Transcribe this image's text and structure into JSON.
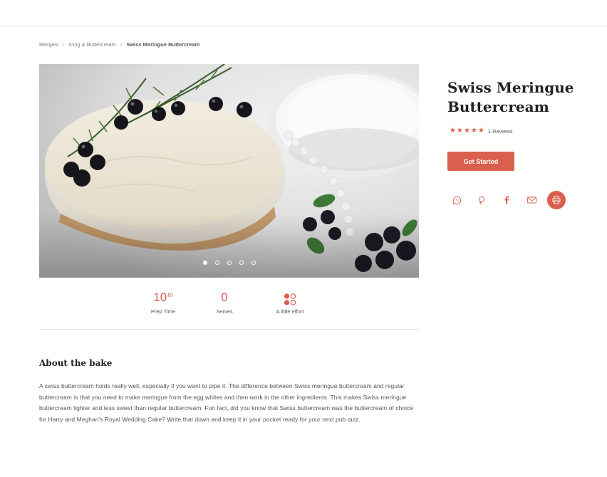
{
  "breadcrumb": {
    "items": [
      "Recipes",
      "Icing & Buttercream",
      "Swiss Meringue Buttercream"
    ],
    "separator": "›"
  },
  "hero": {
    "image_alt": "Cake topped with white buttercream, blackcurrants and rosemary",
    "slide_count": 5,
    "active_slide": 1
  },
  "stats": {
    "prep_time": {
      "value": "10",
      "unit": "m",
      "label": "Prep Time"
    },
    "serves": {
      "value": "0",
      "label": "Serves"
    },
    "effort": {
      "label": "A little effort",
      "icon": "effort-dots-icon"
    }
  },
  "about": {
    "title": "About the bake",
    "text": "A swiss buttercream holds really well, especially if you want to pipe it. The difference between Swiss meringue buttercream and regular buttercream is that you need to make meringue from the egg whites and then work in the other ingredients. This makes Swiss meringue buttercream lighter and less sweet than regular buttercream. Fun fact, did you know that Swiss buttercream was the buttercream of choice for Harry and Meghan's Royal Wedding Cake? Write that down and keep it in your pocket ready for your next pub quiz."
  },
  "recipe": {
    "title": "Swiss Meringue Buttercream",
    "rating": 5,
    "reviews_label": "1 Reviews",
    "cta_label": "Get Started"
  },
  "share": {
    "icons": [
      "whatsapp-icon",
      "pinterest-icon",
      "facebook-icon",
      "email-icon",
      "print-icon"
    ]
  },
  "colors": {
    "accent": "#d9604c",
    "text": "#333333",
    "muted": "#555555",
    "divider": "#e2e2e2"
  }
}
